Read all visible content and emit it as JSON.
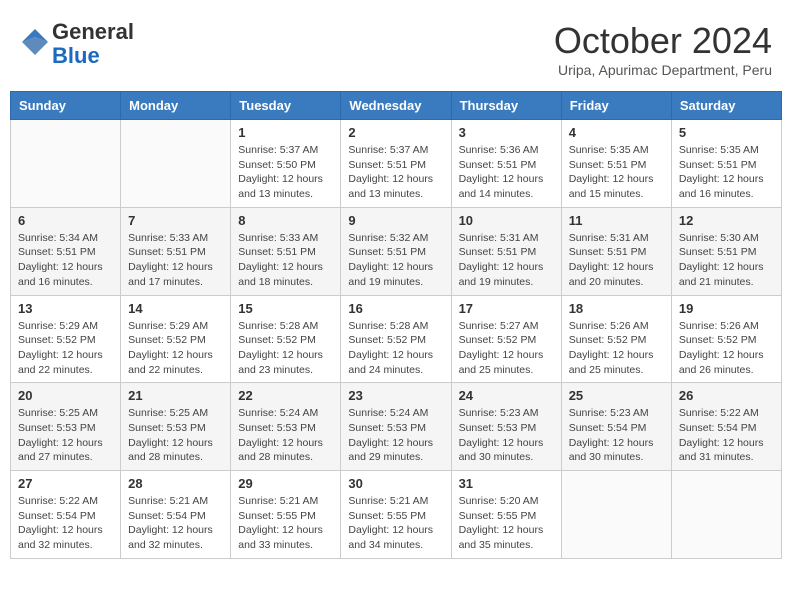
{
  "logo": {
    "line1": "General",
    "line2": "Blue"
  },
  "title": "October 2024",
  "subtitle": "Uripa, Apurimac Department, Peru",
  "headers": [
    "Sunday",
    "Monday",
    "Tuesday",
    "Wednesday",
    "Thursday",
    "Friday",
    "Saturday"
  ],
  "weeks": [
    [
      {
        "day": "",
        "info": ""
      },
      {
        "day": "",
        "info": ""
      },
      {
        "day": "1",
        "info": "Sunrise: 5:37 AM\nSunset: 5:50 PM\nDaylight: 12 hours and 13 minutes."
      },
      {
        "day": "2",
        "info": "Sunrise: 5:37 AM\nSunset: 5:51 PM\nDaylight: 12 hours and 13 minutes."
      },
      {
        "day": "3",
        "info": "Sunrise: 5:36 AM\nSunset: 5:51 PM\nDaylight: 12 hours and 14 minutes."
      },
      {
        "day": "4",
        "info": "Sunrise: 5:35 AM\nSunset: 5:51 PM\nDaylight: 12 hours and 15 minutes."
      },
      {
        "day": "5",
        "info": "Sunrise: 5:35 AM\nSunset: 5:51 PM\nDaylight: 12 hours and 16 minutes."
      }
    ],
    [
      {
        "day": "6",
        "info": "Sunrise: 5:34 AM\nSunset: 5:51 PM\nDaylight: 12 hours and 16 minutes."
      },
      {
        "day": "7",
        "info": "Sunrise: 5:33 AM\nSunset: 5:51 PM\nDaylight: 12 hours and 17 minutes."
      },
      {
        "day": "8",
        "info": "Sunrise: 5:33 AM\nSunset: 5:51 PM\nDaylight: 12 hours and 18 minutes."
      },
      {
        "day": "9",
        "info": "Sunrise: 5:32 AM\nSunset: 5:51 PM\nDaylight: 12 hours and 19 minutes."
      },
      {
        "day": "10",
        "info": "Sunrise: 5:31 AM\nSunset: 5:51 PM\nDaylight: 12 hours and 19 minutes."
      },
      {
        "day": "11",
        "info": "Sunrise: 5:31 AM\nSunset: 5:51 PM\nDaylight: 12 hours and 20 minutes."
      },
      {
        "day": "12",
        "info": "Sunrise: 5:30 AM\nSunset: 5:51 PM\nDaylight: 12 hours and 21 minutes."
      }
    ],
    [
      {
        "day": "13",
        "info": "Sunrise: 5:29 AM\nSunset: 5:52 PM\nDaylight: 12 hours and 22 minutes."
      },
      {
        "day": "14",
        "info": "Sunrise: 5:29 AM\nSunset: 5:52 PM\nDaylight: 12 hours and 22 minutes."
      },
      {
        "day": "15",
        "info": "Sunrise: 5:28 AM\nSunset: 5:52 PM\nDaylight: 12 hours and 23 minutes."
      },
      {
        "day": "16",
        "info": "Sunrise: 5:28 AM\nSunset: 5:52 PM\nDaylight: 12 hours and 24 minutes."
      },
      {
        "day": "17",
        "info": "Sunrise: 5:27 AM\nSunset: 5:52 PM\nDaylight: 12 hours and 25 minutes."
      },
      {
        "day": "18",
        "info": "Sunrise: 5:26 AM\nSunset: 5:52 PM\nDaylight: 12 hours and 25 minutes."
      },
      {
        "day": "19",
        "info": "Sunrise: 5:26 AM\nSunset: 5:52 PM\nDaylight: 12 hours and 26 minutes."
      }
    ],
    [
      {
        "day": "20",
        "info": "Sunrise: 5:25 AM\nSunset: 5:53 PM\nDaylight: 12 hours and 27 minutes."
      },
      {
        "day": "21",
        "info": "Sunrise: 5:25 AM\nSunset: 5:53 PM\nDaylight: 12 hours and 28 minutes."
      },
      {
        "day": "22",
        "info": "Sunrise: 5:24 AM\nSunset: 5:53 PM\nDaylight: 12 hours and 28 minutes."
      },
      {
        "day": "23",
        "info": "Sunrise: 5:24 AM\nSunset: 5:53 PM\nDaylight: 12 hours and 29 minutes."
      },
      {
        "day": "24",
        "info": "Sunrise: 5:23 AM\nSunset: 5:53 PM\nDaylight: 12 hours and 30 minutes."
      },
      {
        "day": "25",
        "info": "Sunrise: 5:23 AM\nSunset: 5:54 PM\nDaylight: 12 hours and 30 minutes."
      },
      {
        "day": "26",
        "info": "Sunrise: 5:22 AM\nSunset: 5:54 PM\nDaylight: 12 hours and 31 minutes."
      }
    ],
    [
      {
        "day": "27",
        "info": "Sunrise: 5:22 AM\nSunset: 5:54 PM\nDaylight: 12 hours and 32 minutes."
      },
      {
        "day": "28",
        "info": "Sunrise: 5:21 AM\nSunset: 5:54 PM\nDaylight: 12 hours and 32 minutes."
      },
      {
        "day": "29",
        "info": "Sunrise: 5:21 AM\nSunset: 5:55 PM\nDaylight: 12 hours and 33 minutes."
      },
      {
        "day": "30",
        "info": "Sunrise: 5:21 AM\nSunset: 5:55 PM\nDaylight: 12 hours and 34 minutes."
      },
      {
        "day": "31",
        "info": "Sunrise: 5:20 AM\nSunset: 5:55 PM\nDaylight: 12 hours and 35 minutes."
      },
      {
        "day": "",
        "info": ""
      },
      {
        "day": "",
        "info": ""
      }
    ]
  ]
}
